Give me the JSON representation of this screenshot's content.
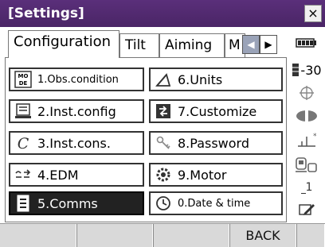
{
  "window": {
    "title": "[Settings]",
    "close_label": "×"
  },
  "tabs": [
    {
      "label": "Configuration",
      "active": true
    },
    {
      "label": "Tilt",
      "active": false
    },
    {
      "label": "Aiming",
      "active": false
    },
    {
      "label": "M",
      "active": false
    }
  ],
  "tab_nav": {
    "prev_label": "◀",
    "next_label": "▶"
  },
  "menu": [
    {
      "label": "1.Obs.condition",
      "icon": "mode-icon",
      "selected": false
    },
    {
      "label": "2.Inst.config",
      "icon": "config-icon",
      "selected": false
    },
    {
      "label": "3.Inst.cons.",
      "icon": "constant-c-icon",
      "selected": false
    },
    {
      "label": "4.EDM",
      "icon": "edm-icon",
      "selected": false
    },
    {
      "label": "5.Comms",
      "icon": "comms-icon",
      "selected": true
    },
    {
      "label": "6.Units",
      "icon": "units-angle-icon",
      "selected": false
    },
    {
      "label": "7.Customize",
      "icon": "customize-icon",
      "selected": false
    },
    {
      "label": "8.Password",
      "icon": "key-icon",
      "selected": false
    },
    {
      "label": "9.Motor",
      "icon": "motor-icon",
      "selected": false
    },
    {
      "label": "0.Date & time",
      "icon": "clock-icon",
      "selected": false
    }
  ],
  "status": {
    "prism_constant": "-30",
    "battery_icon": "battery-icon",
    "target_icon": "target-crosshair-icon",
    "edm_icon": "edm-signal-icon",
    "tilt_icon": "tilt-level-icon",
    "device_icon": "instrument-icon",
    "page_indicator": "1",
    "input_icon": "input-mode-icon"
  },
  "softkeys": [
    "",
    "",
    "",
    "BACK",
    ""
  ]
}
